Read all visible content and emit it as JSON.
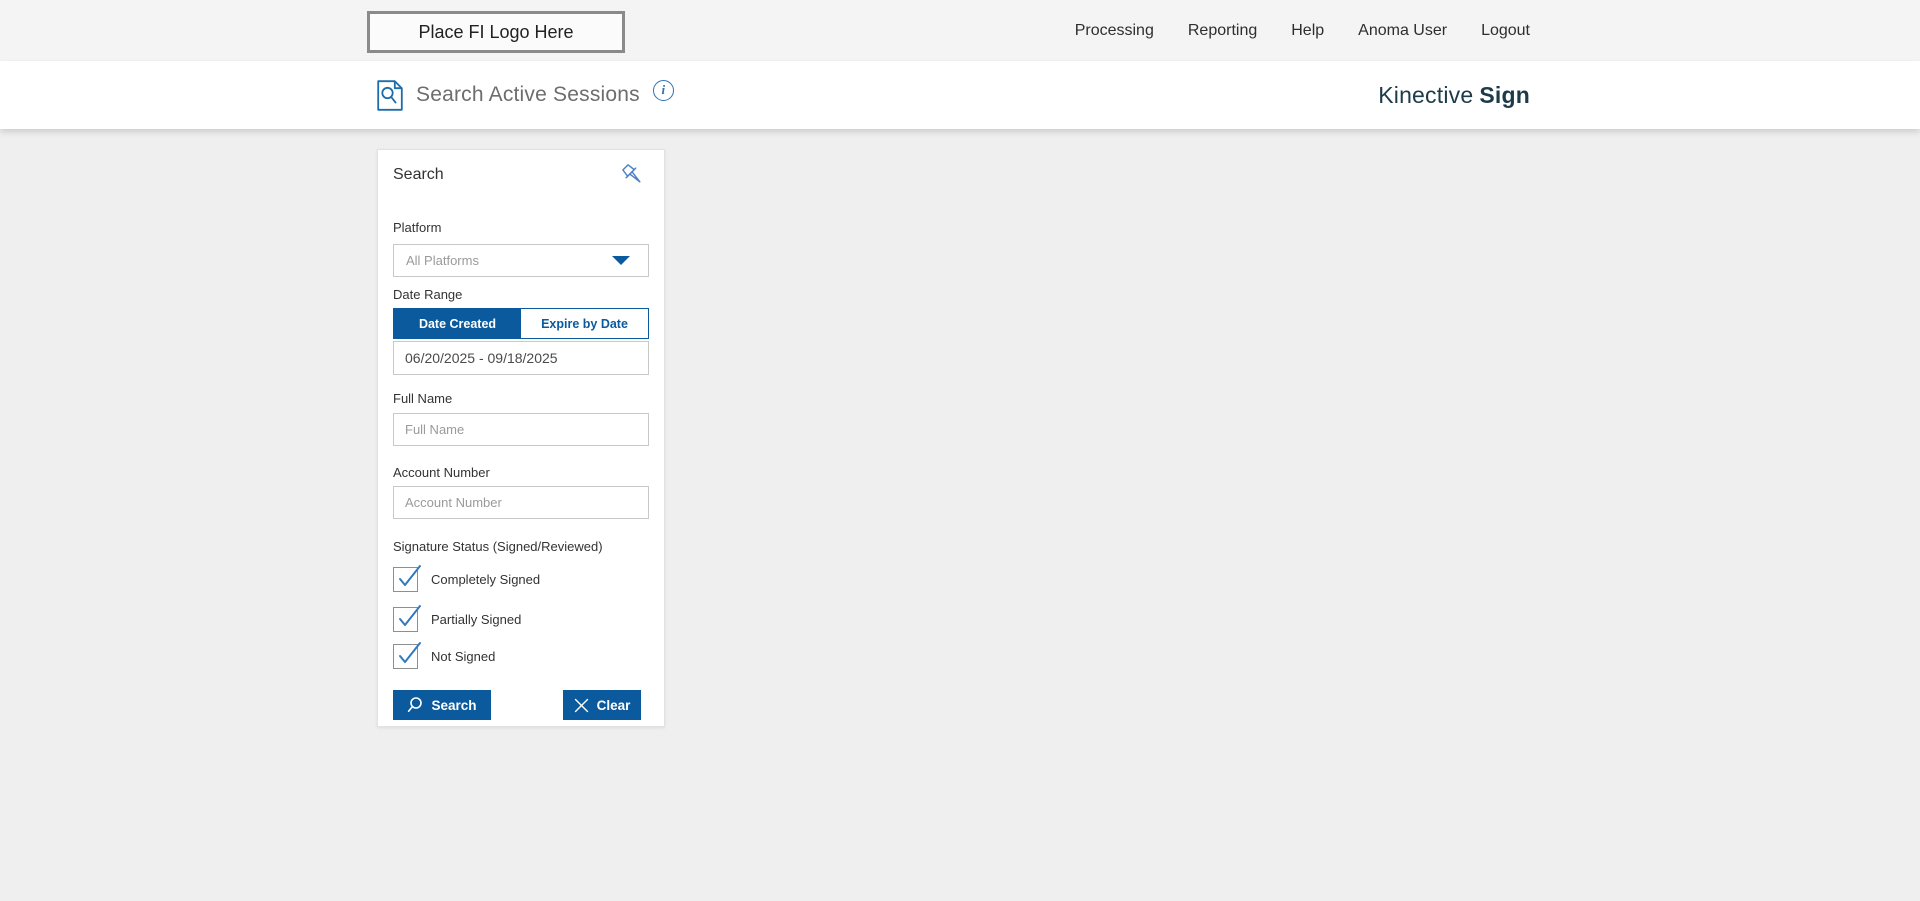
{
  "topbar": {
    "logo_text": "Place FI Logo Here",
    "nav": [
      {
        "label": "Processing"
      },
      {
        "label": "Reporting"
      },
      {
        "label": "Help"
      },
      {
        "label": "Anoma User"
      },
      {
        "label": "Logout"
      }
    ]
  },
  "header": {
    "title": "Search Active Sessions",
    "info_glyph": "i",
    "brand_name": "Kinective",
    "brand_product": "Sign"
  },
  "search_panel": {
    "title": "Search",
    "platform": {
      "label": "Platform",
      "selected": "All Platforms"
    },
    "date_range": {
      "label": "Date Range",
      "tabs": [
        {
          "label": "Date Created",
          "active": true
        },
        {
          "label": "Expire by Date",
          "active": false
        }
      ],
      "value": "06/20/2025 - 09/18/2025"
    },
    "full_name": {
      "label": "Full Name",
      "placeholder": "Full Name",
      "value": ""
    },
    "account_number": {
      "label": "Account Number",
      "placeholder": "Account Number",
      "value": ""
    },
    "signature_status": {
      "label": "Signature Status (Signed/Reviewed)",
      "options": [
        {
          "label": "Completely Signed",
          "checked": true
        },
        {
          "label": "Partially Signed",
          "checked": true
        },
        {
          "label": "Not Signed",
          "checked": true
        }
      ]
    },
    "buttons": {
      "search": "Search",
      "clear": "Clear"
    }
  },
  "colors": {
    "primary_blue": "#0a5a9d",
    "check_blue": "#3079bd",
    "brand_dark": "#1d3a49",
    "topbar_bg": "#f4f4f4",
    "content_bg": "#efefef"
  }
}
